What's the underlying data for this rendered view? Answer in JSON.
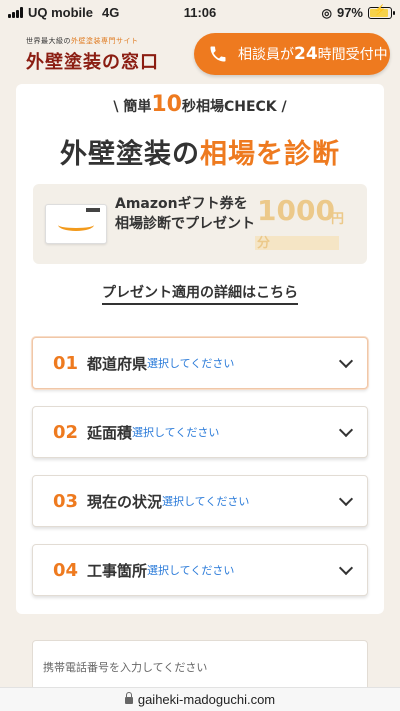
{
  "status_bar": {
    "carrier": "UQ mobile",
    "network": "4G",
    "time": "11:06",
    "battery": "97%",
    "battery_level": 0.97
  },
  "header": {
    "logo_tagline_prefix": "世界最大級の",
    "logo_tagline_accent": "外壁塗装専門サイト",
    "logo_text": "外壁塗装の窓口",
    "call_button": {
      "prefix": "相談員が",
      "hours": "24",
      "suffix": "時間受付中"
    }
  },
  "hero": {
    "catch_prefix": "\\ 簡単",
    "catch_number": "10",
    "catch_suffix": "秒相場CHECK /",
    "title_main": "外壁塗装の",
    "title_accent": "相場を診断"
  },
  "gift": {
    "text": "Amazonギフト券を相場診断でプレゼント",
    "amount": "1000",
    "unit1": "円",
    "unit2": "分"
  },
  "detail_link": "プレゼント適用の詳細はこちら",
  "selects": [
    {
      "num": "01",
      "label": "都道府県",
      "hint": "選択してください"
    },
    {
      "num": "02",
      "label": "延面積",
      "hint": "選択してください"
    },
    {
      "num": "03",
      "label": "現在の状況",
      "hint": "選択してください"
    },
    {
      "num": "04",
      "label": "工事箇所",
      "hint": "選択してください"
    }
  ],
  "phone": {
    "placeholder": "携帯電話番号を入力してください"
  },
  "url": "gaiheki-madoguchi.com",
  "colors": {
    "accent": "#ee7a1f",
    "logo": "#8b1d12",
    "hint": "#2b7bd9",
    "background": "#f4efe8"
  }
}
